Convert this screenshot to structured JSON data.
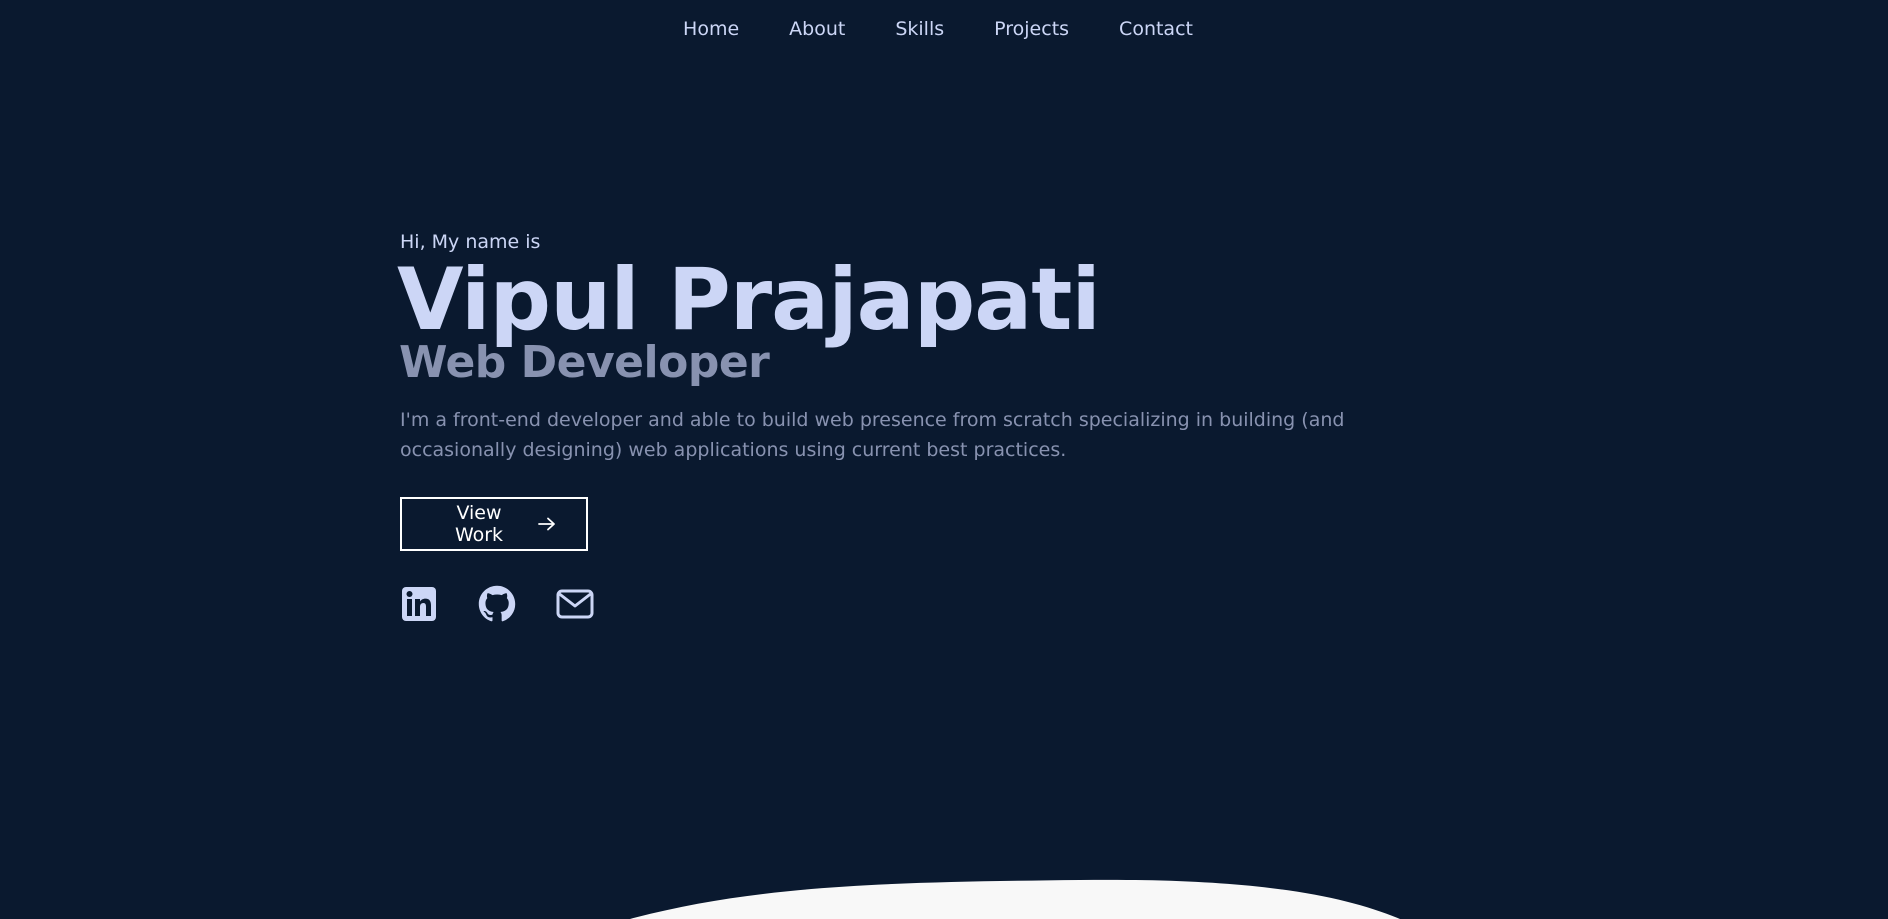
{
  "nav": {
    "items": [
      {
        "label": "Home"
      },
      {
        "label": "About"
      },
      {
        "label": "Skills"
      },
      {
        "label": "Projects"
      },
      {
        "label": "Contact"
      }
    ]
  },
  "hero": {
    "intro": "Hi, My name is",
    "name": "Vipul Prajapati",
    "role": "Web Developer",
    "description": "I'm a front-end developer and able to build web presence from scratch specializing in building (and occasionally designing) web applications using current best practices.",
    "cta_label": "View Work",
    "cta_icon": "arrow-right-icon"
  },
  "socials": [
    {
      "icon": "linkedin-icon"
    },
    {
      "icon": "github-icon"
    },
    {
      "icon": "mail-icon"
    }
  ],
  "colors": {
    "background": "#0a192f",
    "heading": "#ccd6f6",
    "muted": "#8892b0",
    "button_border": "#ffffff",
    "curve": "#f8f8f8"
  }
}
